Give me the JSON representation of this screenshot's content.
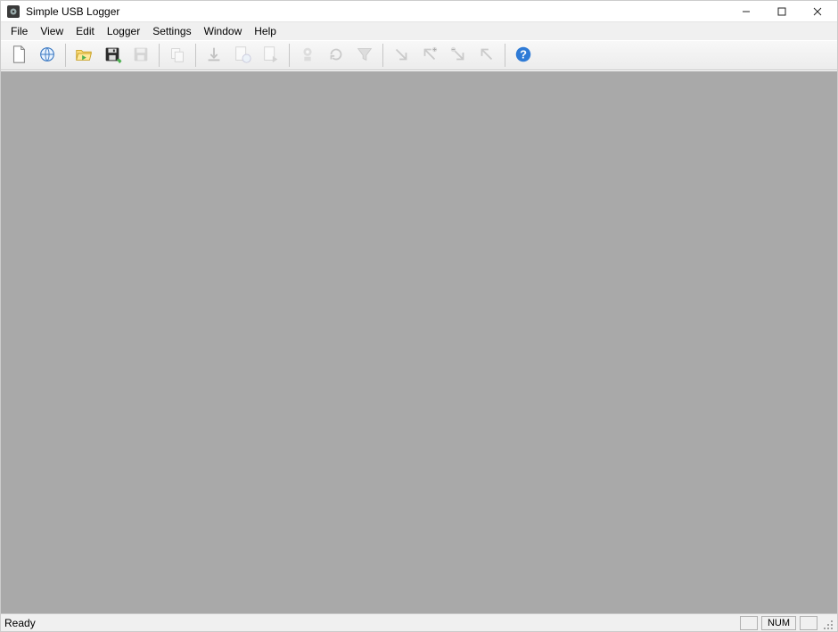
{
  "title": "Simple USB Logger",
  "menu": {
    "items": [
      "File",
      "View",
      "Edit",
      "Logger",
      "Settings",
      "Window",
      "Help"
    ]
  },
  "toolbar": {
    "groups": [
      [
        "new",
        "globe"
      ],
      [
        "open",
        "save",
        "save-as"
      ],
      [
        "copy"
      ],
      [
        "download",
        "upload",
        "export"
      ],
      [
        "device-settings",
        "refresh",
        "filter"
      ],
      [
        "arrow-down",
        "arrow-up-plus",
        "arrow-down-minus",
        "arrow-up"
      ],
      [
        "help"
      ]
    ]
  },
  "status": {
    "ready": "Ready",
    "blank1": "",
    "num": "NUM",
    "blank2": ""
  }
}
